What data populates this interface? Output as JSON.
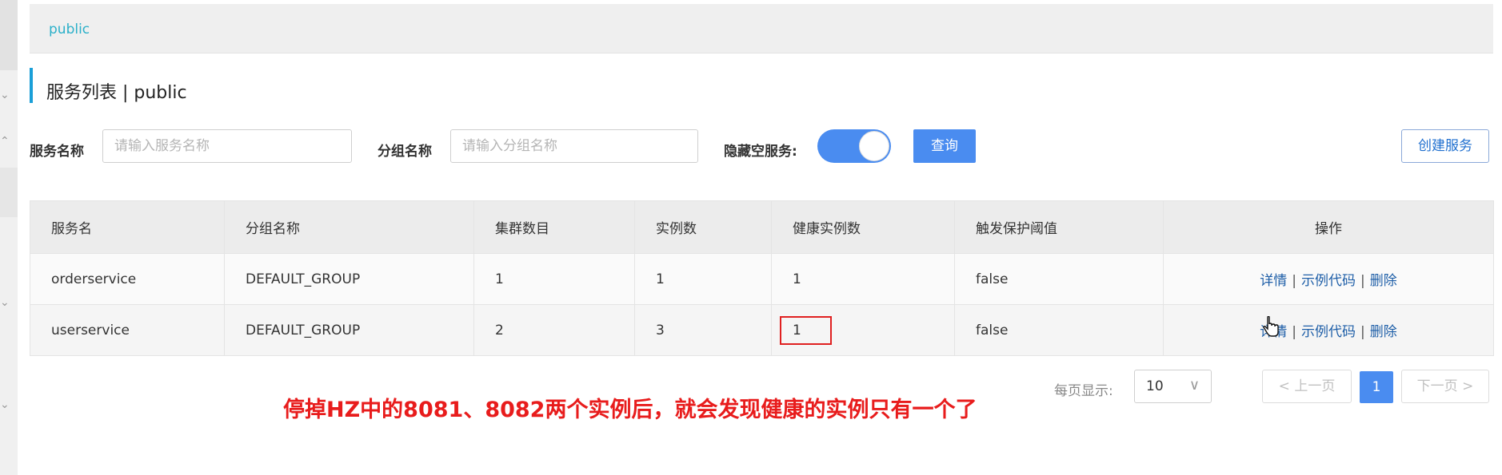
{
  "namespace": {
    "label": "public"
  },
  "title": {
    "text": "服务列表 | public"
  },
  "search": {
    "service_label": "服务名称",
    "service_placeholder": "请输入服务名称",
    "service_value": "",
    "group_label": "分组名称",
    "group_placeholder": "请输入分组名称",
    "group_value": "",
    "hide_empty_label": "隐藏空服务:",
    "hide_empty_on": true,
    "query_button": "查询",
    "create_button": "创建服务"
  },
  "table": {
    "headers": [
      "服务名",
      "分组名称",
      "集群数目",
      "实例数",
      "健康实例数",
      "触发保护阈值",
      "操作"
    ],
    "rows": [
      [
        "orderservice",
        "DEFAULT_GROUP",
        "1",
        "1",
        "1",
        "false"
      ],
      [
        "userservice",
        "DEFAULT_GROUP",
        "2",
        "3",
        "1",
        "false"
      ]
    ],
    "actions": {
      "detail": "详情",
      "sample_code": "示例代码",
      "delete": "删除",
      "separator": "|"
    }
  },
  "pagination": {
    "per_page_label": "每页显示:",
    "per_page_value": "10",
    "prev": "< 上一页",
    "current_page": "1",
    "next": "下一页 >"
  },
  "annotation": {
    "text": "停掉HZ中的8081、8082两个实例后，就会发现健康的实例只有一个了"
  },
  "colors": {
    "primary": "#4a8cf0",
    "annotation": "#e81c1c",
    "link": "#1f5fa8",
    "title_bar": "#1a9fd8",
    "namespace": "#2bb0c9"
  },
  "icons": {
    "select_arrow": "chevron-down-icon",
    "cursor": "hand-pointer-icon"
  }
}
